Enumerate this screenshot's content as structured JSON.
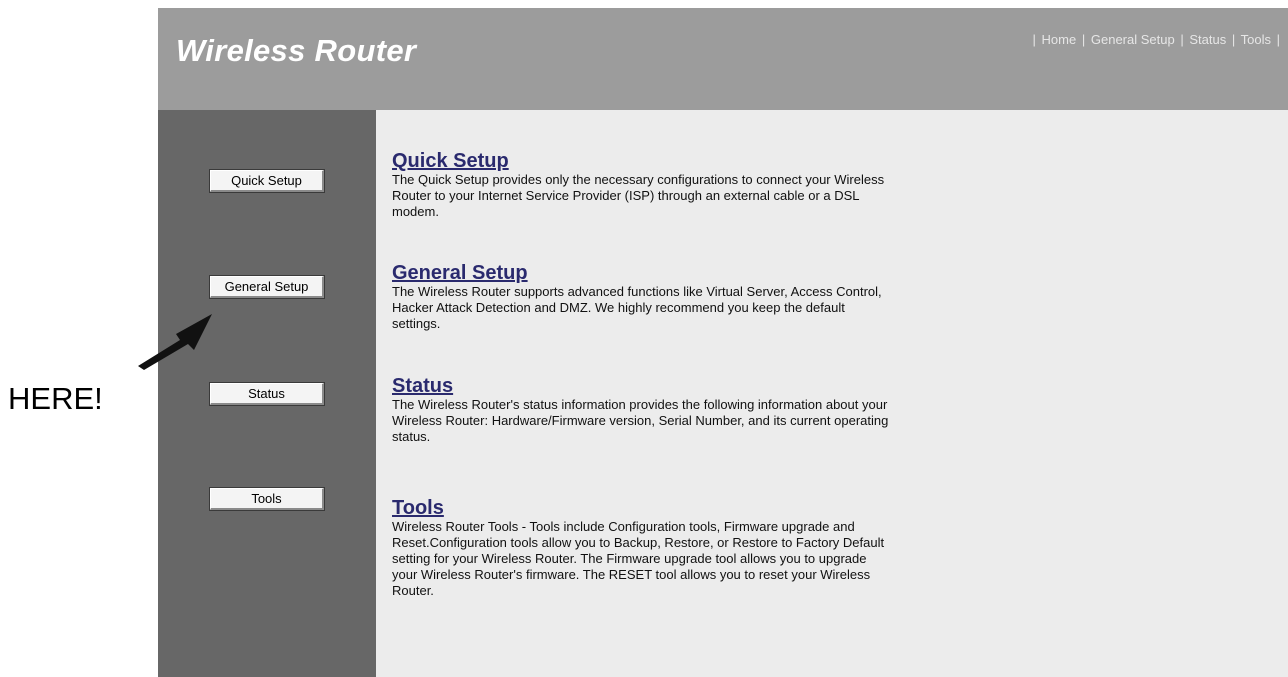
{
  "header": {
    "title": "Wireless Router",
    "nav": {
      "sep": "|",
      "items": [
        "Home",
        "General Setup",
        "Status",
        "Tools"
      ]
    }
  },
  "sidebar": {
    "buttons": [
      "Quick Setup",
      "General Setup",
      "Status",
      "Tools"
    ]
  },
  "main": {
    "sections": [
      {
        "title": "Quick Setup",
        "text": "The Quick Setup provides only the necessary configurations to connect your Wireless Router to your Internet Service Provider (ISP) through an external cable or a DSL modem."
      },
      {
        "title": "General Setup",
        "text": "The Wireless Router supports advanced functions like Virtual Server, Access Control, Hacker Attack Detection and DMZ. We highly recommend you keep the default settings."
      },
      {
        "title": "Status",
        "text": "The Wireless Router's status information provides the following information about your Wireless Router: Hardware/Firmware version, Serial Number, and its current operating status."
      },
      {
        "title": "Tools",
        "text": "Wireless Router Tools - Tools include Configuration tools, Firmware upgrade and Reset.Configuration tools allow you to Backup, Restore, or Restore to Factory Default setting for your Wireless Router. The Firmware upgrade tool allows you to upgrade your Wireless Router's firmware. The RESET tool allows you to reset your Wireless Router."
      }
    ]
  },
  "annotation": {
    "label": "HERE!",
    "icon": "arrow-icon"
  }
}
